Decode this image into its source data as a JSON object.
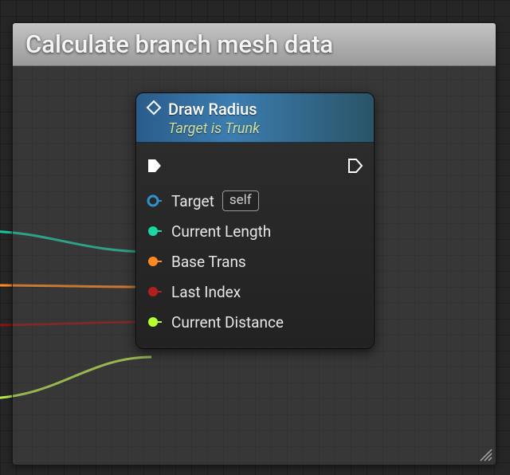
{
  "comment": {
    "title": "Calculate branch mesh data"
  },
  "node": {
    "title": "Draw Radius",
    "subtitle": "Target is Trunk",
    "pins": {
      "target": {
        "label": "Target",
        "self_text": "self",
        "color": "#2e93c8"
      },
      "currentLength": {
        "label": "Current Length",
        "color": "#1dd6a3"
      },
      "baseTrans": {
        "label": "Base Trans",
        "color": "#ff8a1f"
      },
      "lastIndex": {
        "label": "Last Index",
        "color": "#b11f1f"
      },
      "currentDistance": {
        "label": "Current Distance",
        "color": "#b4ff2e"
      }
    }
  }
}
